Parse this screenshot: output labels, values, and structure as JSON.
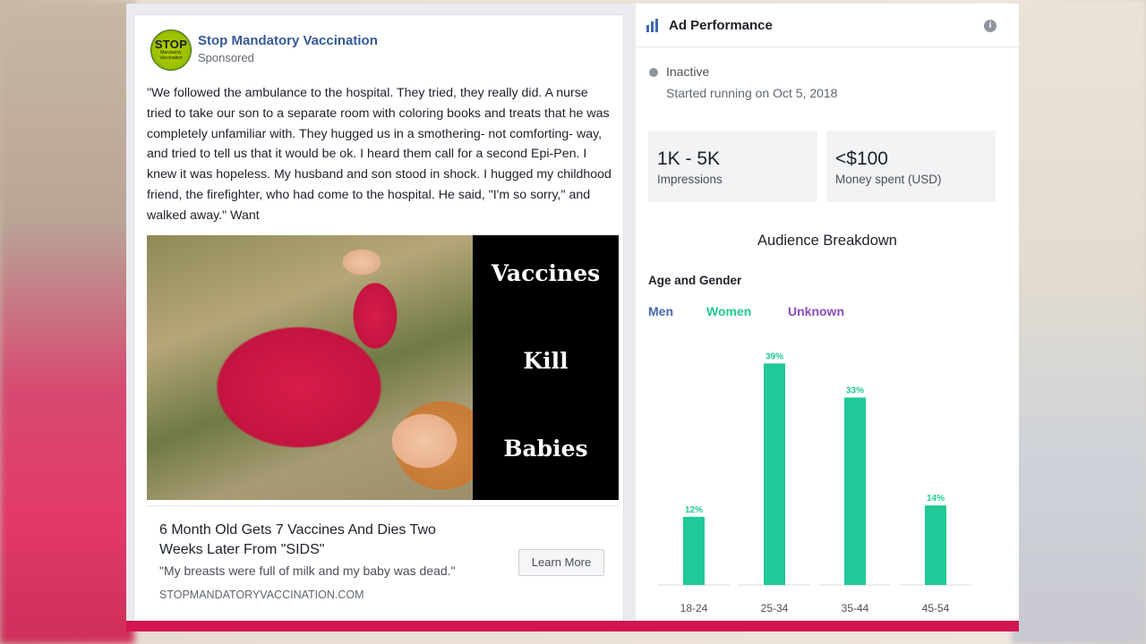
{
  "ad": {
    "page_name": "Stop Mandatory Vaccination",
    "sponsored": "Sponsored",
    "avatar_text": "STOP",
    "avatar_subtext": "Mandatory Vaccination",
    "post_text": "\"We followed the ambulance to the hospital. They tried, they really did. A nurse tried to take our son to a separate room with coloring books and treats that he was completely unfamiliar with. They hugged us in a smothering- not comforting- way, and tried to tell us that it would be ok. I heard them call for a second Epi-Pen. I knew it was hopeless. My husband and son stood in shock. I hugged my childhood friend, the firefighter, who had come to the hospital. He said, \"I'm so sorry,\" and walked away.\" Want",
    "image_words": [
      "Vaccines",
      "Kill",
      "Babies"
    ],
    "link_title": "6 Month Old Gets 7 Vaccines And Dies Two Weeks Later From \"SIDS\"",
    "link_description": "\"My breasts were full of milk and my baby was dead.\"",
    "link_domain": "STOPMANDATORYVACCINATION.COM",
    "cta_label": "Learn More"
  },
  "performance": {
    "title": "Ad Performance",
    "info_icon": "i",
    "status": "Inactive",
    "started": "Started running on Oct 5, 2018",
    "impressions_value": "1K - 5K",
    "impressions_label": "Impressions",
    "spent_value": "<$100",
    "spent_label": "Money spent (USD)",
    "breakdown_title": "Audience Breakdown",
    "age_gender_title": "Age and Gender",
    "legend": {
      "men": "Men",
      "women": "Women",
      "unknown": "Unknown"
    },
    "colors": {
      "men": "#4267b2",
      "women": "#20c997",
      "unknown": "#8c4bc0",
      "status_inactive": "#8d949e"
    }
  },
  "chart_data": {
    "type": "bar",
    "title": "",
    "xlabel": "",
    "ylabel": "",
    "categories": [
      "18-24",
      "25-34",
      "35-44",
      "45-54"
    ],
    "series": [
      {
        "name": "Women",
        "values": [
          12,
          39,
          33,
          14
        ]
      }
    ],
    "data_labels": [
      "12%",
      "39%",
      "33%",
      "14%"
    ],
    "ylim": [
      0,
      40
    ],
    "grid": false
  }
}
